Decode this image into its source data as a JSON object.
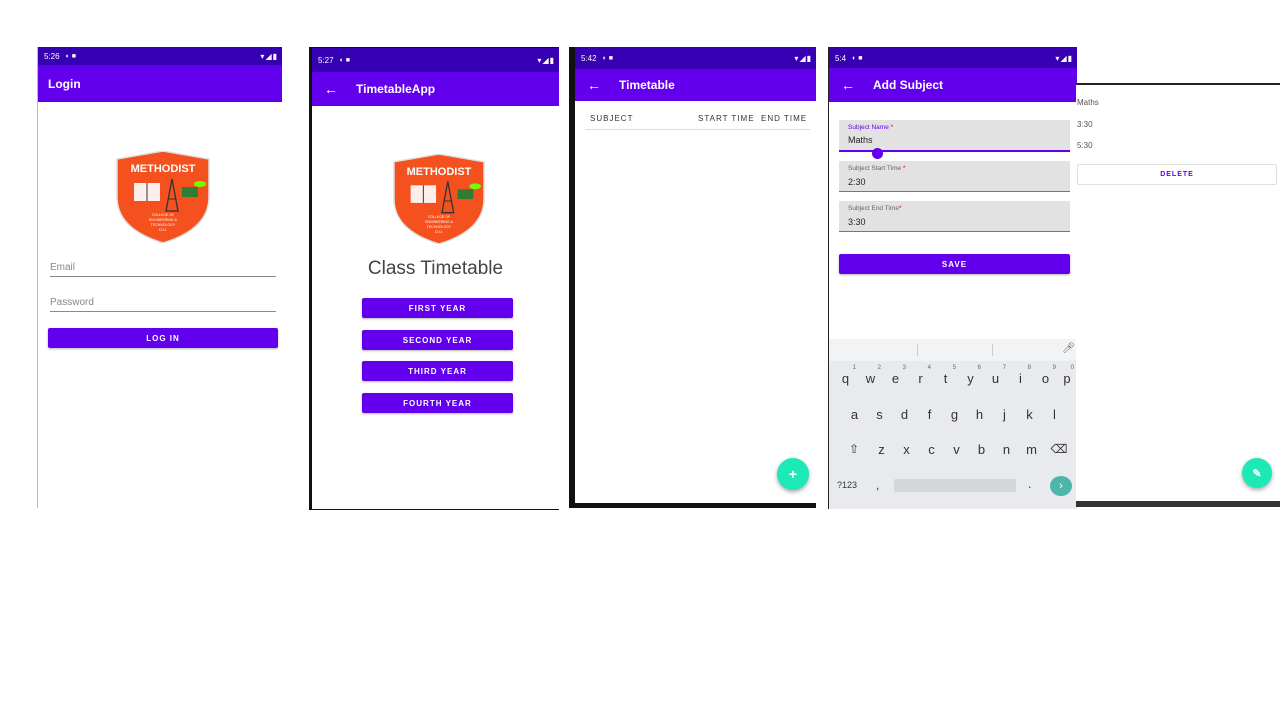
{
  "login_screen": {
    "status_time": "5:26",
    "title": "Login",
    "logo_text": "METHODIST",
    "logo_subtext": "COLLEGE OF ENGINEERING & TECHNOLOGY",
    "logo_ou": "O.U.",
    "email_placeholder": "Email",
    "password_placeholder": "Password",
    "login_button": "LOG IN"
  },
  "home_screen": {
    "status_time": "5:27",
    "title": "TimetableApp",
    "logo_text": "METHODIST",
    "logo_subtext": "COLLEGE OF ENGINEERING & TECHNOLOGY",
    "logo_ou": "O.U.",
    "heading": "Class Timetable",
    "buttons": [
      "FIRST YEAR",
      "SECOND YEAR",
      "THIRD YEAR",
      "FOURTH YEAR"
    ]
  },
  "timetable_screen": {
    "status_time": "5:42",
    "title": "Timetable",
    "columns": [
      "SUBJECT",
      "START TIME",
      "END TIME"
    ],
    "fab_label": "+"
  },
  "add_subject_screen": {
    "status_time": "5:4",
    "title": "Add Subject",
    "fields": [
      {
        "label": "Subject Name",
        "required": "*",
        "value": "Maths"
      },
      {
        "label": "Subject Start Time",
        "required": "*",
        "value": "2:30"
      },
      {
        "label": "Subject End Time",
        "required": "*",
        "value": "3:30"
      }
    ],
    "save_button": "SAVE",
    "keyboard": {
      "row1": [
        "q",
        "w",
        "e",
        "r",
        "t",
        "y",
        "u",
        "i",
        "o",
        "p"
      ],
      "row1_numbers": [
        "1",
        "2",
        "3",
        "4",
        "5",
        "6",
        "7",
        "8",
        "9",
        "0"
      ],
      "row2": [
        "a",
        "s",
        "d",
        "f",
        "g",
        "h",
        "j",
        "k",
        "l"
      ],
      "row3": [
        "z",
        "x",
        "c",
        "v",
        "b",
        "n",
        "m"
      ],
      "symbols_key": "?123",
      "comma_key": ",",
      "period_key": "."
    }
  },
  "detail_screen": {
    "subject": "Maths",
    "start_time": "3:30",
    "end_time": "5:30",
    "delete_button": "DELETE"
  },
  "colors": {
    "primary": "#6200ee",
    "primary_dark": "#3700b3",
    "accent": "#1de9b6",
    "logo_orange": "#f4511e"
  },
  "icons": [
    "back-arrow-icon",
    "wifi-icon",
    "signal-icon",
    "battery-icon",
    "mic-icon",
    "backspace-icon",
    "shift-icon",
    "pencil-icon"
  ]
}
